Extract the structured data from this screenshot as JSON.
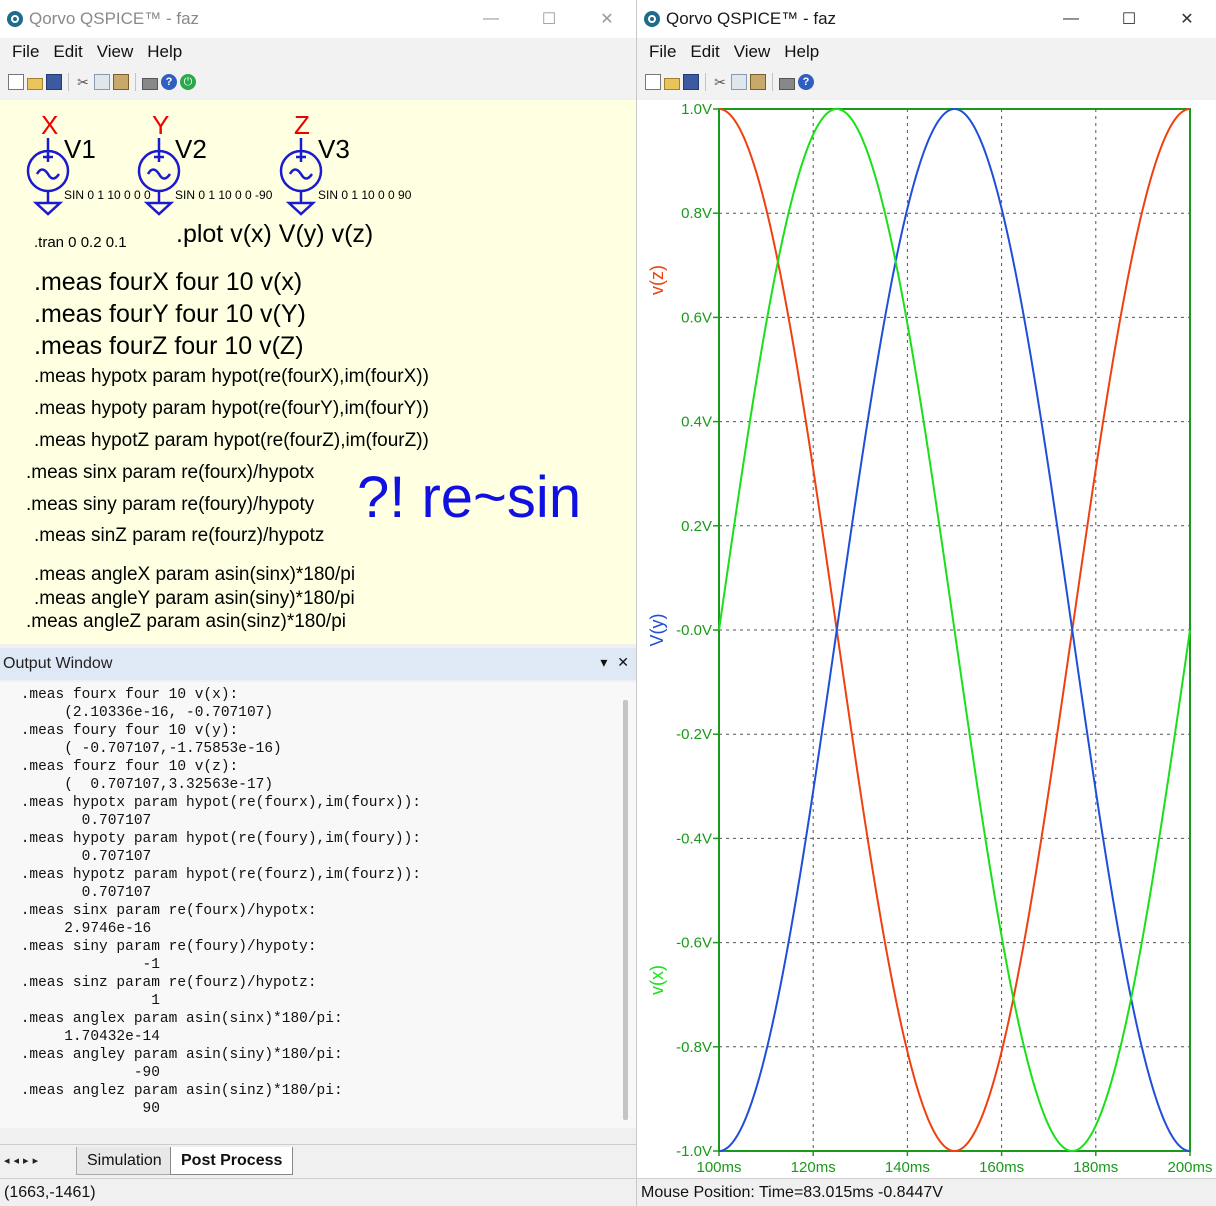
{
  "left": {
    "title": "Qorvo QSPICE™ - faz",
    "window_buttons": {
      "min": "—",
      "max": "☐",
      "close": "✕"
    },
    "menu": [
      "File",
      "Edit",
      "View",
      "Help"
    ],
    "schematic": {
      "sources": [
        {
          "net": "X",
          "name": "V1",
          "params": "SIN 0 1 10 0 0 0"
        },
        {
          "net": "Y",
          "name": "V2",
          "params": "SIN 0 1 10 0 0 -90"
        },
        {
          "net": "Z",
          "name": "V3",
          "params": "SIN 0 1 10 0 0 90"
        }
      ],
      "tran": ".tran  0 0.2 0.1",
      "plot": ".plot v(x) V(y) v(z)",
      "meas_big": [
        ".meas fourX four 10 v(x)",
        ".meas fourY four 10 v(Y)",
        ".meas fourZ four 10 v(Z)"
      ],
      "meas_hypot": [
        ".meas hypotx param hypot(re(fourX),im(fourX))",
        ".meas hypoty param hypot(re(fourY),im(fourY))",
        ".meas hypotZ param hypot(re(fourZ),im(fourZ))"
      ],
      "meas_sin": [
        ".meas sinx param re(fourx)/hypotx",
        ".meas siny param re(foury)/hypoty",
        ".meas sinZ param re(fourz)/hypotz"
      ],
      "meas_angle": [
        ".meas angleX param asin(sinx)*180/pi",
        ".meas angleY param asin(siny)*180/pi",
        ".meas angleZ param asin(sinz)*180/pi"
      ],
      "note": "?! re~sin"
    },
    "output": {
      "title": "Output Window",
      "pin": "▾",
      "close": "✕",
      "text": " .meas fourx four 10 v(x):\n      (2.10336e-16, -0.707107)\n .meas foury four 10 v(y):\n      ( -0.707107,-1.75853e-16)\n .meas fourz four 10 v(z):\n      (  0.707107,3.32563e-17)\n .meas hypotx param hypot(re(fourx),im(fourx)):\n        0.707107\n .meas hypoty param hypot(re(foury),im(foury)):\n        0.707107\n .meas hypotz param hypot(re(fourz),im(fourz)):\n        0.707107\n .meas sinx param re(fourx)/hypotx:\n      2.9746e-16\n .meas siny param re(foury)/hypoty:\n               -1\n .meas sinz param re(fourz)/hypotz:\n                1\n .meas anglex param asin(sinx)*180/pi:\n      1.70432e-14\n .meas angley param asin(siny)*180/pi:\n              -90\n .meas anglez param asin(sinz)*180/pi:\n               90"
    },
    "tabs": {
      "nav": "◂◂▸▸",
      "simulation": "Simulation",
      "post_process": "Post Process"
    },
    "status": "(1663,-1461)"
  },
  "right": {
    "title": "Qorvo QSPICE™ - faz",
    "window_buttons": {
      "min": "—",
      "max": "☐",
      "close": "✕"
    },
    "menu": [
      "File",
      "Edit",
      "View",
      "Help"
    ],
    "status": "Mouse Position: Time=83.015ms  -0.8447V"
  },
  "colors": {
    "vx": "#19e019",
    "vy": "#1f4fd8",
    "vz": "#f04010",
    "axis": "#1a9a1a",
    "grid": "#555555",
    "note": "#1010e0",
    "net": "#e00000"
  },
  "chart_data": {
    "type": "line",
    "x_unit": "ms",
    "x_range": [
      100,
      200
    ],
    "y_range": [
      -1.0,
      1.0
    ],
    "x_ticks": [
      "100ms",
      "120ms",
      "140ms",
      "160ms",
      "180ms",
      "200ms"
    ],
    "y_ticks": [
      "1.0V",
      "0.8V",
      "0.6V",
      "0.4V",
      "0.2V",
      "-0.0V",
      "-0.2V",
      "-0.4V",
      "-0.6V",
      "-0.8V",
      "-1.0V"
    ],
    "grid": true,
    "series": [
      {
        "name": "v(z)",
        "color": "#f04010",
        "freq_hz": 10,
        "phase_deg": 90
      },
      {
        "name": "V(y)",
        "color": "#1f4fd8",
        "freq_hz": 10,
        "phase_deg": -90
      },
      {
        "name": "v(x)",
        "color": "#19e019",
        "freq_hz": 10,
        "phase_deg": 0
      }
    ]
  }
}
